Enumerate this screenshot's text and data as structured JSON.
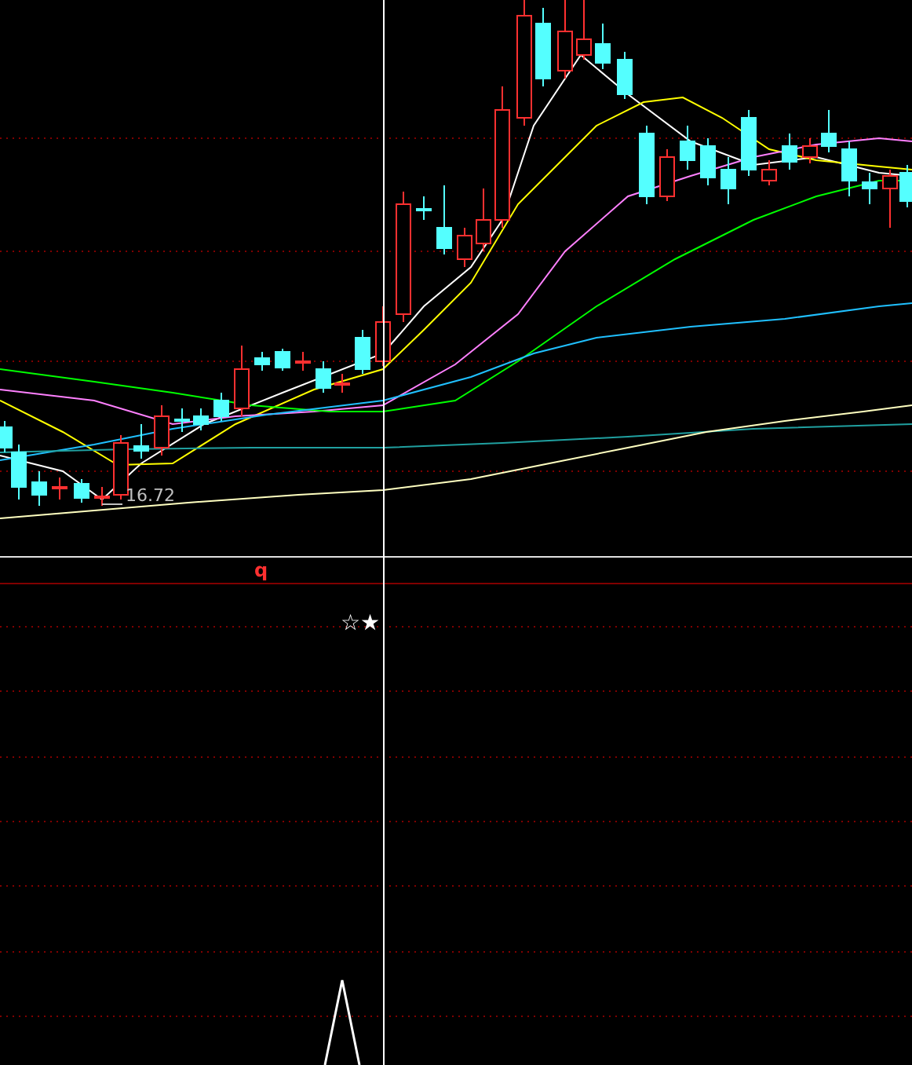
{
  "price_panel": {
    "low_label": "16.72"
  },
  "indicator_panel": {
    "label": "q",
    "signal": "☆★"
  }
}
